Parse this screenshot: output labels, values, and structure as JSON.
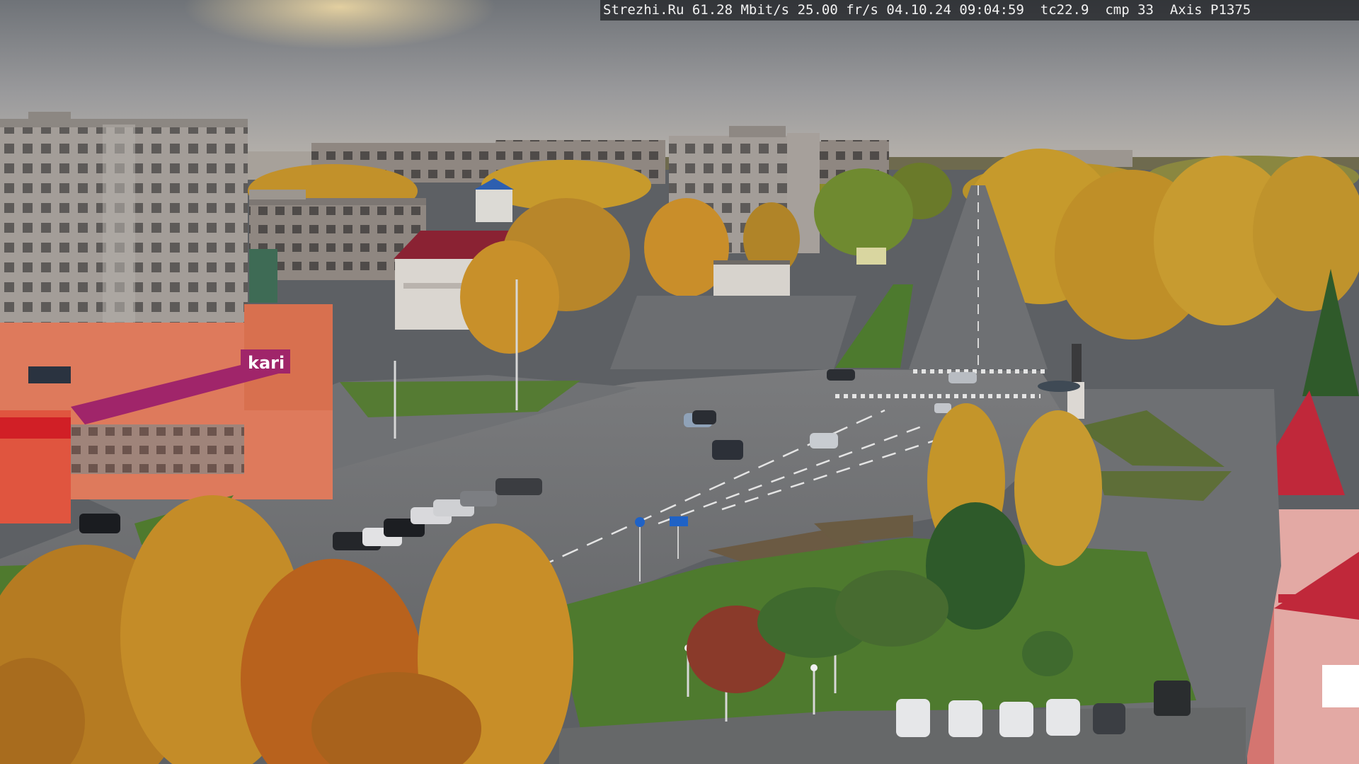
{
  "overlay": {
    "site": "Strezhi.Ru",
    "bitrate": "61.28 Mbit/s",
    "framerate": "25.00 fr/s",
    "date": "04.10.24",
    "time": "09:04:59",
    "tc": "tc22.9",
    "cmp": "cmp 33",
    "camera_model": "Axis P1375"
  },
  "scene": {
    "store_sign": "kari",
    "colors": {
      "sky_top": "#6f7378",
      "sky_horizon": "#b9b4ad",
      "road": "#6a6c6f",
      "grass": "#4f7a2f",
      "foliage_gold": "#c89526",
      "foliage_orange": "#b86a1c",
      "kari_brand": "#a0256a",
      "roof_red": "#c0283a"
    }
  }
}
